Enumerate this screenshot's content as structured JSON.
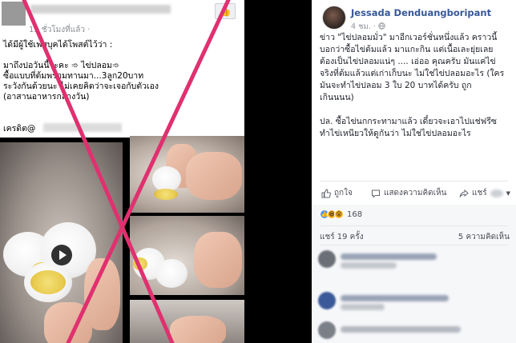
{
  "left_screenshot": {
    "time": "15 ชั่วโมงที่แล้ว ·",
    "like_icon": "thumbs-up-icon",
    "post_text": "ได้มีผู้ใช้เฟสบุคได้โพสต์ไว้ว่า :\n\nมาถึงปอวันนี้วะคะ ➾ ไข่ปลอม➾\nซื้อแบบที่ต้มพร้อมทานมา...3ลูก20บาท\nระวังกันด้วยนะ ไม่เคยคิดว่าจะเจอกับตัวเอง\n(อาสานอาหารกลางวัน)",
    "credit_label": "เครดิต@",
    "cross_color": "#e0306f"
  },
  "post": {
    "author": "Jessada Denduangboripant",
    "timestamp": "4 ชม.",
    "audience_icon": "globe-icon",
    "text": "ข่าว \"ไข่ปลอมมั่ว\" มาอีกเวอร์ชั่นหนึ่งแล้ว คราวนี้\nบอกว่าซื้อไข่ต้มแล้ว มาแกะกิน แต่เนื้อเละยุ่ยเลย\nต้องเป็นไข่ปลอมแน่ๆ .... เอ่ออ คุณครับ มันแค่ไข่\nจริงที่ต้มแล้วแต่เก่าเก็บนะ ไม่ใช่ไข่ปลอมอะไร (ใคร\nมันจะทำไข่ปลอม 3 ใบ 20 บาทได้ครับ ถูก\nเกินนนน)\n\nปล. ซื้อไข่นกกระทามาแล้ว เดี๋ยวจะเอาไปแช่ฟรีซ\nทำไข่เหนียวให้ดูกันว่า ไม่ใช่ไข่ปลอมอะไร",
    "actions": {
      "like": "ถูกใจ",
      "comment": "แสดงความคิดเห็น",
      "share": "แชร์"
    },
    "reaction_count": "168",
    "shares": "แชร์ 19 ครั้ง",
    "comments": "5 ความคิดเห็น",
    "colors": {
      "link": "#365899",
      "text": "#1d2129",
      "secondary": "#90949c"
    }
  }
}
